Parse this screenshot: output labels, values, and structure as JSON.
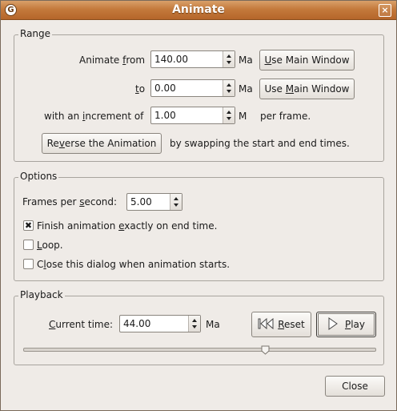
{
  "window": {
    "title": "Animate",
    "close_glyph": "×",
    "app_icon": "G"
  },
  "range": {
    "legend": "Range",
    "from_label_pre": "Animate ",
    "from_label_key": "f",
    "from_label_post": "rom",
    "from_value": "140.00",
    "from_unit": "Ma",
    "from_button_key": "U",
    "from_button_post": "se Main Window",
    "to_label_key": "t",
    "to_label_post": "o",
    "to_value": "0.00",
    "to_unit": "Ma",
    "to_button_pre": "Use ",
    "to_button_key": "M",
    "to_button_post": "ain Window",
    "inc_label_pre": "with an ",
    "inc_label_key": "i",
    "inc_label_post": "ncrement of",
    "inc_value": "1.00",
    "inc_unit": "M",
    "inc_suffix": "per frame.",
    "reverse_pre": "Re",
    "reverse_key": "v",
    "reverse_post": "erse the Animation",
    "reverse_desc": "by swapping the start and end times."
  },
  "options": {
    "legend": "Options",
    "fps_label_pre": "Frames per ",
    "fps_label_key": "s",
    "fps_label_post": "econd:",
    "fps_value": "5.00",
    "finish_pre": "Finish animation ",
    "finish_key": "e",
    "finish_post": "xactly on end time.",
    "finish_checked": true,
    "loop_key": "L",
    "loop_post": "oop.",
    "loop_checked": false,
    "close_pre": "C",
    "close_key": "l",
    "close_post": "ose this dialog when animation starts.",
    "close_checked": false
  },
  "playback": {
    "legend": "Playback",
    "current_key": "C",
    "current_post": "urrent time:",
    "current_value": "44.00",
    "current_unit": "Ma",
    "reset_key": "R",
    "reset_post": "eset",
    "play_key": "P",
    "play_post": "lay",
    "slider_fraction": 0.686
  },
  "footer": {
    "close_label": "Close"
  }
}
